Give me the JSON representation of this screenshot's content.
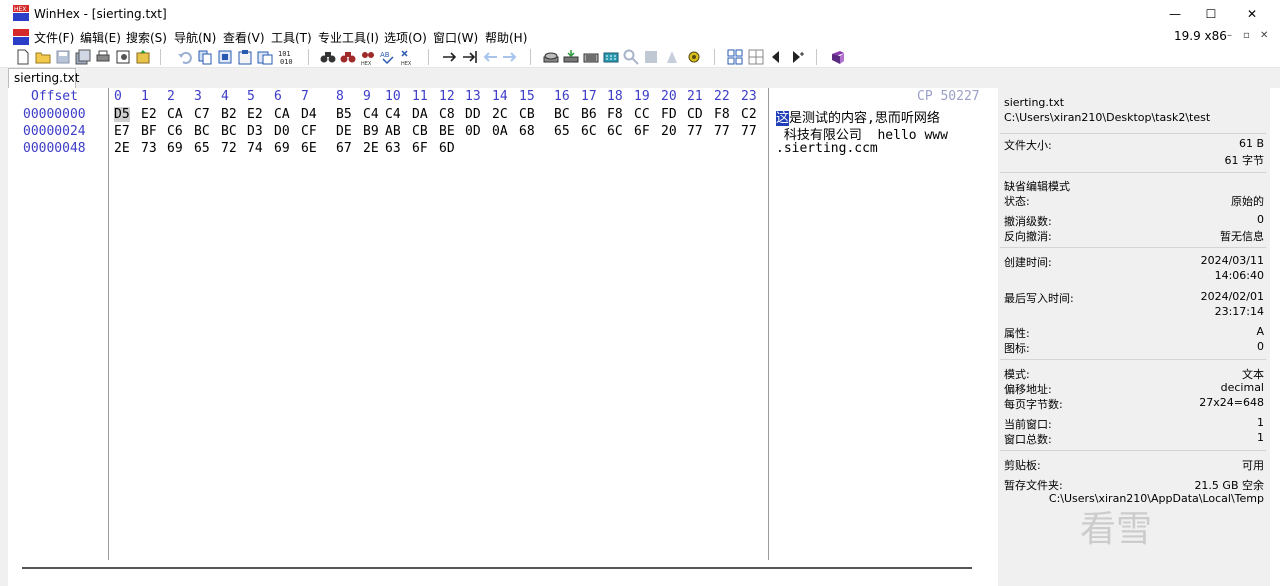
{
  "window": {
    "title": "WinHex - [sierting.txt]",
    "controls": {
      "minimize": "—",
      "maximize": "☐",
      "close": "✕"
    }
  },
  "menu": {
    "items": [
      "文件(F)",
      "编辑(E)",
      "搜索(S)",
      "导航(N)",
      "查看(V)",
      "工具(T)",
      "专业工具(I)",
      "选项(O)",
      "窗口(W)",
      "帮助(H)"
    ],
    "zoom": "19.9 x86",
    "mdi_buttons": [
      "–",
      "▫",
      "✕"
    ]
  },
  "tab": {
    "label": "sierting.txt"
  },
  "editor": {
    "offset_header": "Offset",
    "columns": [
      "0",
      "1",
      "2",
      "3",
      "4",
      "5",
      "6",
      "7",
      "8",
      "9",
      "10",
      "11",
      "12",
      "13",
      "14",
      "15",
      "16",
      "17",
      "18",
      "19",
      "20",
      "21",
      "22",
      "23"
    ],
    "codepage": "CP 50227",
    "rows": [
      {
        "offset": "00000000",
        "bytes": [
          "D5",
          "E2",
          "CA",
          "C7",
          "B2",
          "E2",
          "CA",
          "D4",
          "B5",
          "C4",
          "C4",
          "DA",
          "C8",
          "DD",
          "2C",
          "CB",
          "BC",
          "B6",
          "F8",
          "CC",
          "FD",
          "CD",
          "F8",
          "C2"
        ],
        "text": "这是测试的内容,思而听网络"
      },
      {
        "offset": "00000024",
        "bytes": [
          "E7",
          "BF",
          "C6",
          "BC",
          "BC",
          "D3",
          "D0",
          "CF",
          "DE",
          "B9",
          "AB",
          "CB",
          "BE",
          "0D",
          "0A",
          "68",
          "65",
          "6C",
          "6C",
          "6F",
          "20",
          "77",
          "77",
          "77"
        ],
        "text": " 科技有限公司  hello www"
      },
      {
        "offset": "00000048",
        "bytes": [
          "2E",
          "73",
          "69",
          "65",
          "72",
          "74",
          "69",
          "6E",
          "67",
          "2E",
          "63",
          "6F",
          "6D"
        ],
        "text": ".sierting.ccm"
      }
    ]
  },
  "panel": {
    "filename": "sierting.txt",
    "path": "C:\\Users\\xiran210\\Desktop\\task2\\test",
    "file_size_label": "文件大小:",
    "file_size": "61 B",
    "file_size_bytes": "61 字节",
    "edit_mode_label": "缺省编辑模式",
    "state_label": "状态:",
    "state": "原始的",
    "undo_level_label": "撤消级数:",
    "undo_level": "0",
    "reverse_undo_label": "反向撤消:",
    "reverse_undo": "暂无信息",
    "created_label": "创建时间:",
    "created_date": "2024/03/11",
    "created_time": "14:06:40",
    "modified_label": "最后写入时间:",
    "modified_date": "2024/02/01",
    "modified_time": "23:17:14",
    "attr_label": "属性:",
    "attr": "A",
    "icon_label": "图标:",
    "icon": "0",
    "mode_label": "模式:",
    "mode": "文本",
    "offset_addr_label": "偏移地址:",
    "offset_addr": "decimal",
    "bytes_per_page_label": "每页字节数:",
    "bytes_per_page": "27x24=648",
    "current_window_label": "当前窗口:",
    "current_window": "1",
    "window_total_label": "窗口总数:",
    "window_total": "1",
    "clipboard_label": "剪贴板:",
    "clipboard": "可用",
    "temp_folder_label": "暂存文件夹:",
    "temp_free": "21.5 GB 空余",
    "temp_path": "C:\\Users\\xiran210\\AppData\\Local\\Temp"
  },
  "watermark": "看雪",
  "colors": {
    "offset_blue": "#3c3cc8",
    "cursor_blue": "#1f3fb8"
  }
}
